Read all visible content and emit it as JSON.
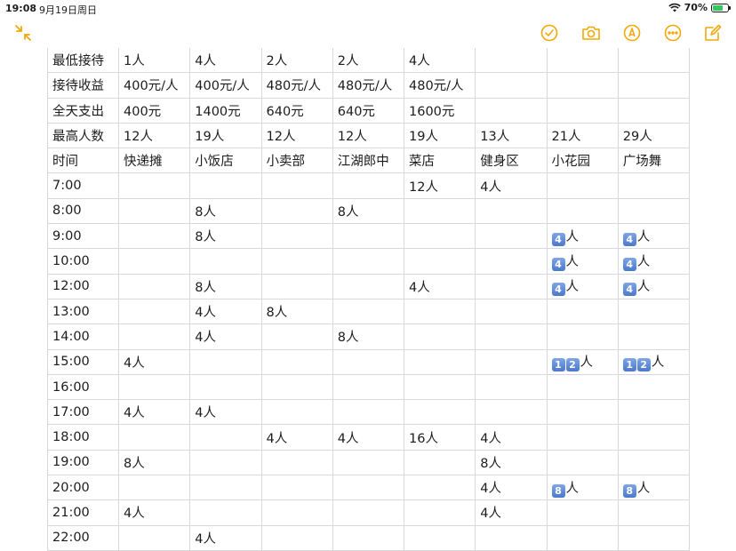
{
  "status": {
    "time": "19:08",
    "date": "9月19日周日",
    "battery": "70%",
    "battery_level": 0.7,
    "accent": "#f0a80a"
  },
  "toolbar": {
    "icons": [
      "shrink-icon",
      "checklist-icon",
      "camera-icon",
      "markup-icon",
      "more-icon",
      "compose-icon"
    ]
  },
  "table": {
    "rows": [
      [
        "最低接待",
        "1人",
        "4人",
        "2人",
        "2人",
        "4人",
        "",
        "",
        ""
      ],
      [
        "接待收益",
        "400元/人",
        "400元/人",
        "480元/人",
        "480元/人",
        "480元/人",
        "",
        "",
        ""
      ],
      [
        "全天支出",
        "400元",
        "1400元",
        "640元",
        "640元",
        "1600元",
        "",
        "",
        ""
      ],
      [
        "最高人数",
        "12人",
        "19人",
        "12人",
        "12人",
        "19人",
        "13人",
        "21人",
        "29人"
      ],
      [
        "时间",
        "快递摊",
        "小饭店",
        "小卖部",
        "江湖郎中",
        "菜店",
        "健身区",
        "小花园",
        "广场舞"
      ],
      [
        "7:00",
        "",
        "",
        "",
        "",
        "12人",
        "4人",
        "",
        ""
      ],
      [
        "8:00",
        "",
        "8人",
        "",
        "8人",
        "",
        "",
        "",
        ""
      ],
      [
        "9:00",
        "",
        "8人",
        "",
        "",
        "",
        "",
        "[4]人",
        "[4]人"
      ],
      [
        "10:00",
        "",
        "",
        "",
        "",
        "",
        "",
        "[4]人",
        "[4]人"
      ],
      [
        "12:00",
        "",
        "8人",
        "",
        "",
        "4人",
        "",
        "[4]人",
        "[4]人"
      ],
      [
        "13:00",
        "",
        "4人",
        "8人",
        "",
        "",
        "",
        "",
        ""
      ],
      [
        "14:00",
        "",
        "4人",
        "",
        "8人",
        "",
        "",
        "",
        ""
      ],
      [
        "15:00",
        "4人",
        "",
        "",
        "",
        "",
        "",
        "[1][2]人",
        "[1][2]人"
      ],
      [
        "16:00",
        "",
        "",
        "",
        "",
        "",
        "",
        "",
        ""
      ],
      [
        "17:00",
        "4人",
        "4人",
        "",
        "",
        "",
        "",
        "",
        ""
      ],
      [
        "18:00",
        "",
        "",
        "4人",
        "4人",
        "16人",
        "4人",
        "",
        ""
      ],
      [
        "19:00",
        "8人",
        "",
        "",
        "",
        "",
        "8人",
        "",
        ""
      ],
      [
        "20:00",
        "",
        "",
        "",
        "",
        "",
        "4人",
        "[8]人",
        "[8]人"
      ],
      [
        "21:00",
        "4人",
        "",
        "",
        "",
        "",
        "4人",
        "",
        ""
      ],
      [
        "22:00",
        "",
        "4人",
        "",
        "",
        "",
        "",
        "",
        ""
      ]
    ]
  }
}
